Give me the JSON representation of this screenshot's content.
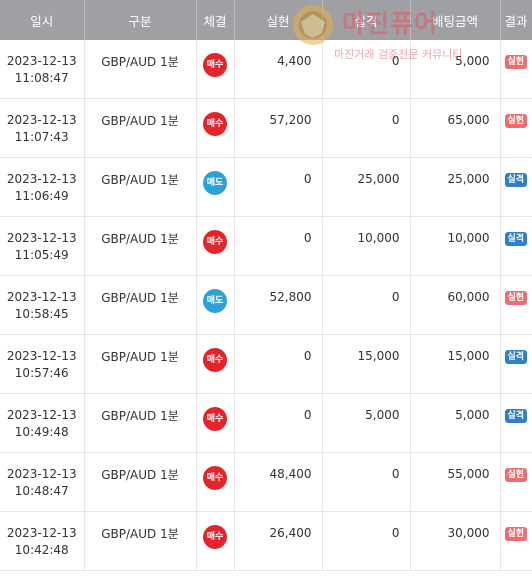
{
  "headers": [
    "일시",
    "구분",
    "체결",
    "실현",
    "실격",
    "배팅금액",
    "결과"
  ],
  "rows": [
    {
      "date": "2023-12-13",
      "time": "11:08:47",
      "kind": "GBP/AUD 1분",
      "exec": "매수",
      "exec_type": "buy",
      "win": "4,400",
      "lose": "0",
      "bet": "5,000",
      "result": "실현",
      "result_type": "win"
    },
    {
      "date": "2023-12-13",
      "time": "11:07:43",
      "kind": "GBP/AUD 1분",
      "exec": "매수",
      "exec_type": "buy",
      "win": "57,200",
      "lose": "0",
      "bet": "65,000",
      "result": "실현",
      "result_type": "win"
    },
    {
      "date": "2023-12-13",
      "time": "11:06:49",
      "kind": "GBP/AUD 1분",
      "exec": "매도",
      "exec_type": "sell",
      "win": "0",
      "lose": "25,000",
      "bet": "25,000",
      "result": "실격",
      "result_type": "lose"
    },
    {
      "date": "2023-12-13",
      "time": "11:05:49",
      "kind": "GBP/AUD 1분",
      "exec": "매수",
      "exec_type": "buy",
      "win": "0",
      "lose": "10,000",
      "bet": "10,000",
      "result": "실격",
      "result_type": "lose"
    },
    {
      "date": "2023-12-13",
      "time": "10:58:45",
      "kind": "GBP/AUD 1분",
      "exec": "매도",
      "exec_type": "sell",
      "win": "52,800",
      "lose": "0",
      "bet": "60,000",
      "result": "실현",
      "result_type": "win"
    },
    {
      "date": "2023-12-13",
      "time": "10:57:46",
      "kind": "GBP/AUD 1분",
      "exec": "매수",
      "exec_type": "buy",
      "win": "0",
      "lose": "15,000",
      "bet": "15,000",
      "result": "실격",
      "result_type": "lose"
    },
    {
      "date": "2023-12-13",
      "time": "10:49:48",
      "kind": "GBP/AUD 1분",
      "exec": "매수",
      "exec_type": "buy",
      "win": "0",
      "lose": "5,000",
      "bet": "5,000",
      "result": "실격",
      "result_type": "lose"
    },
    {
      "date": "2023-12-13",
      "time": "10:48:47",
      "kind": "GBP/AUD 1분",
      "exec": "매수",
      "exec_type": "buy",
      "win": "48,400",
      "lose": "0",
      "bet": "55,000",
      "result": "실현",
      "result_type": "win"
    },
    {
      "date": "2023-12-13",
      "time": "10:42:48",
      "kind": "GBP/AUD 1분",
      "exec": "매수",
      "exec_type": "buy",
      "win": "26,400",
      "lose": "0",
      "bet": "30,000",
      "result": "실현",
      "result_type": "win"
    }
  ],
  "watermark": {
    "title": "마진퓨어",
    "subtitle": "마진거래 검증전문 커뮤니티"
  },
  "colors": {
    "header_bg": "#9ea0a4",
    "buy": "#e3242b",
    "sell": "#2ba3d8",
    "win_badge": "#ef6c6c",
    "lose_badge": "#2f7fd1"
  }
}
